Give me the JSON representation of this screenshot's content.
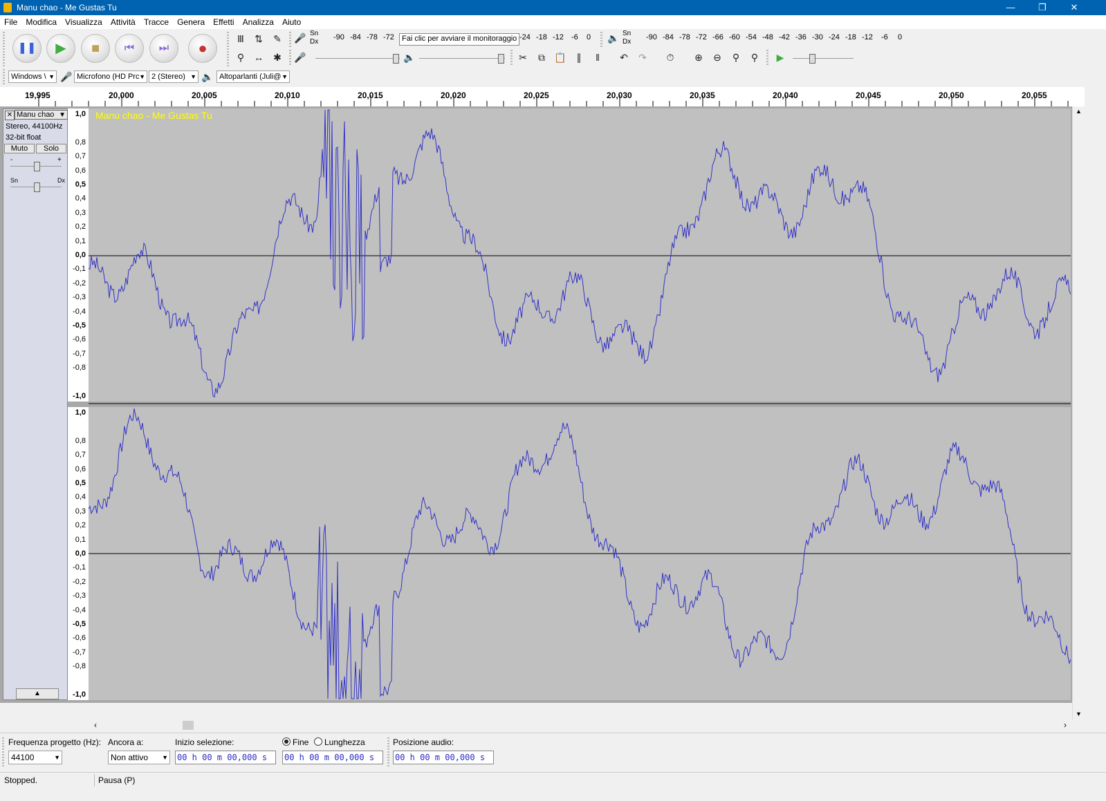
{
  "window": {
    "title": "Manu chao - Me Gustas Tu"
  },
  "menu": [
    "File",
    "Modifica",
    "Visualizza",
    "Attività",
    "Tracce",
    "Genera",
    "Effetti",
    "Analizza",
    "Aiuto"
  ],
  "meters": {
    "record_labels": {
      "left": "Sn",
      "right": "Dx"
    },
    "record_ticks": [
      "-90",
      "-84",
      "-78",
      "-72"
    ],
    "record_ticks_end": [
      "-24",
      "-18",
      "-12",
      "-6",
      "0"
    ],
    "monitor_hint": "Fai clic per avviare il monitoraggio",
    "play_labels": {
      "left": "Sn",
      "right": "Dx"
    },
    "play_ticks": [
      "-90",
      "-84",
      "-78",
      "-72",
      "-66",
      "-60",
      "-54",
      "-48",
      "-42",
      "-36",
      "-30",
      "-24",
      "-18",
      "-12",
      "-6",
      "0"
    ]
  },
  "device": {
    "host": "Windows \\",
    "mic": "Microfono (HD Prc",
    "channels": "2 (Stereo)",
    "speakers": "Altoparlanti (Juli@"
  },
  "ruler": {
    "labels": [
      "19,995",
      "20,000",
      "20,005",
      "20,010",
      "20,015",
      "20,020",
      "20,025",
      "20,030",
      "20,035",
      "20,040",
      "20,045",
      "20,050",
      "20,055"
    ]
  },
  "track": {
    "name": "Manu chao",
    "title_overlay": "Manu chao - Me Gustas Tu",
    "format": "Stereo, 44100Hz",
    "bitdepth": "32-bit float",
    "mute": "Muto",
    "solo": "Solo",
    "gain_minus": "-",
    "gain_plus": "+",
    "pan_left": "Sn",
    "pan_right": "Dx",
    "wave_color": "#3232c8",
    "bg_color": "#c0c0c0",
    "title_color": "#ffff00"
  },
  "vruler_labels": [
    "1,0",
    "0,8",
    "0,7",
    "0,6",
    "0,5",
    "0,4",
    "0,3",
    "0,2",
    "0,1",
    "0,0",
    "-0,1",
    "-0,2",
    "-0,3",
    "-0,4",
    "-0,5",
    "-0,6",
    "-0,7",
    "-0,8",
    "-1,0"
  ],
  "selection_bar": {
    "rate_label": "Frequenza progetto (Hz):",
    "rate_value": "44100",
    "snap_label": "Ancora a:",
    "snap_value": "Non attivo",
    "start_label": "Inizio selezione:",
    "start_value": "00 h 00 m 00,000 s",
    "end_radio": "Fine",
    "length_radio": "Lunghezza",
    "end_value": "00 h 00 m 00,000 s",
    "pos_label": "Posizione audio:",
    "pos_value": "00 h 00 m 00,000 s"
  },
  "status": {
    "state": "Stopped.",
    "hint": "Pausa (P)"
  }
}
